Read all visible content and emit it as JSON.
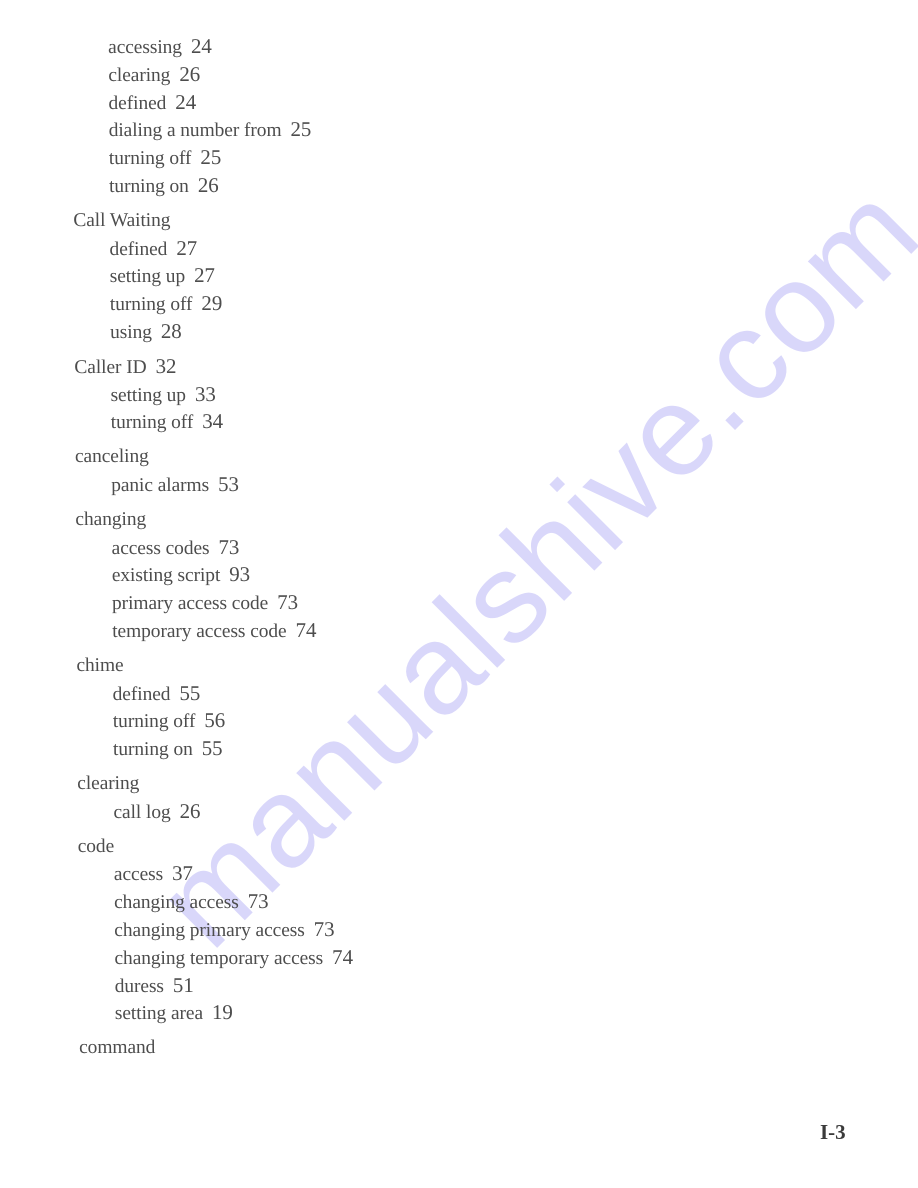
{
  "watermark": {
    "text": "manualshive.com",
    "color": "#d9d7fa"
  },
  "page_number": "I-3",
  "index": [
    {
      "term": null,
      "page": null,
      "continued": true,
      "subentries": [
        {
          "term": "accessing",
          "page": "24"
        },
        {
          "term": "clearing",
          "page": "26"
        },
        {
          "term": "defined",
          "page": "24"
        },
        {
          "term": "dialing a number from",
          "page": "25"
        },
        {
          "term": "turning off",
          "page": "25"
        },
        {
          "term": "turning on",
          "page": "26"
        }
      ]
    },
    {
      "term": "Call Waiting",
      "page": null,
      "subentries": [
        {
          "term": "defined",
          "page": "27"
        },
        {
          "term": "setting up",
          "page": "27"
        },
        {
          "term": "turning off",
          "page": "29"
        },
        {
          "term": "using",
          "page": "28"
        }
      ]
    },
    {
      "term": "Caller ID",
      "page": "32",
      "subentries": [
        {
          "term": "setting up",
          "page": "33"
        },
        {
          "term": "turning off",
          "page": "34"
        }
      ]
    },
    {
      "term": "canceling",
      "page": null,
      "subentries": [
        {
          "term": "panic alarms",
          "page": "53"
        }
      ]
    },
    {
      "term": "changing",
      "page": null,
      "subentries": [
        {
          "term": "access codes",
          "page": "73"
        },
        {
          "term": "existing script",
          "page": "93"
        },
        {
          "term": "primary access code",
          "page": "73"
        },
        {
          "term": "temporary access code",
          "page": "74"
        }
      ]
    },
    {
      "term": "chime",
      "page": null,
      "subentries": [
        {
          "term": "defined",
          "page": "55"
        },
        {
          "term": "turning off",
          "page": "56"
        },
        {
          "term": "turning on",
          "page": "55"
        }
      ]
    },
    {
      "term": "clearing",
      "page": null,
      "subentries": [
        {
          "term": "call log",
          "page": "26"
        }
      ]
    },
    {
      "term": "code",
      "page": null,
      "subentries": [
        {
          "term": "access",
          "page": "37"
        },
        {
          "term": "changing access",
          "page": "73"
        },
        {
          "term": "changing primary access",
          "page": "73"
        },
        {
          "term": "changing temporary access",
          "page": "74"
        },
        {
          "term": "duress",
          "page": "51"
        },
        {
          "term": "setting area",
          "page": "19"
        }
      ]
    },
    {
      "term": "command",
      "page": null,
      "subentries": []
    }
  ]
}
